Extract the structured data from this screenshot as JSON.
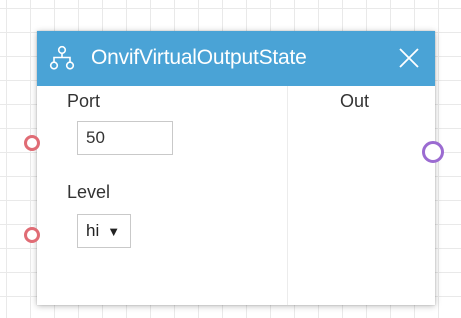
{
  "node": {
    "title": "OnvifVirtualOutputState",
    "header_icon": "network-hierarchy-icon",
    "close_icon": "close-icon",
    "header_color": "#4aa3d6"
  },
  "inputs": {
    "port": {
      "label": "Port",
      "value": "50"
    },
    "level": {
      "label": "Level",
      "selected": "hi"
    }
  },
  "outputs": {
    "out": {
      "label": "Out"
    }
  },
  "colors": {
    "input_connector": "#e06c75",
    "output_connector": "#9b6bd1"
  }
}
